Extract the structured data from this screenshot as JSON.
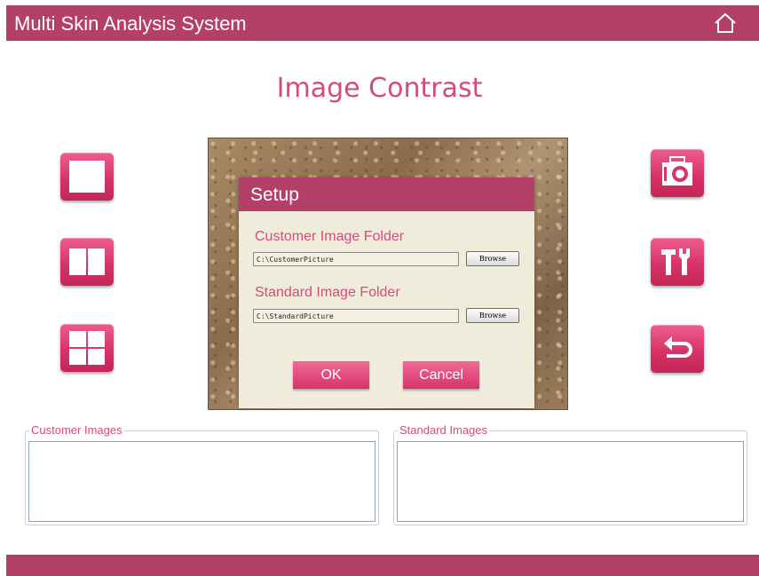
{
  "app": {
    "title": "Multi Skin Analysis System"
  },
  "page": {
    "title": "Image Contrast"
  },
  "colors": {
    "brand": "#b4406a",
    "accent": "#d24c7d",
    "button": "#d73468"
  },
  "toolbar_left": [
    {
      "name": "single-view",
      "icon": "single-pane-icon"
    },
    {
      "name": "two-view",
      "icon": "two-pane-icon"
    },
    {
      "name": "four-view",
      "icon": "four-pane-icon"
    }
  ],
  "toolbar_right": [
    {
      "name": "capture",
      "icon": "camera-icon"
    },
    {
      "name": "setup",
      "icon": "tools-icon"
    },
    {
      "name": "back",
      "icon": "return-icon"
    }
  ],
  "dialog": {
    "title": "Setup",
    "customer_label": "Customer Image Folder",
    "customer_path": "C:\\CustomerPicture",
    "standard_label": "Standard Image Folder",
    "standard_path": "C:\\StandardPicture",
    "browse_label": "Browse",
    "ok_label": "OK",
    "cancel_label": "Cancel"
  },
  "panels": {
    "customer_title": "Customer Images",
    "standard_title": "Standard Images"
  }
}
